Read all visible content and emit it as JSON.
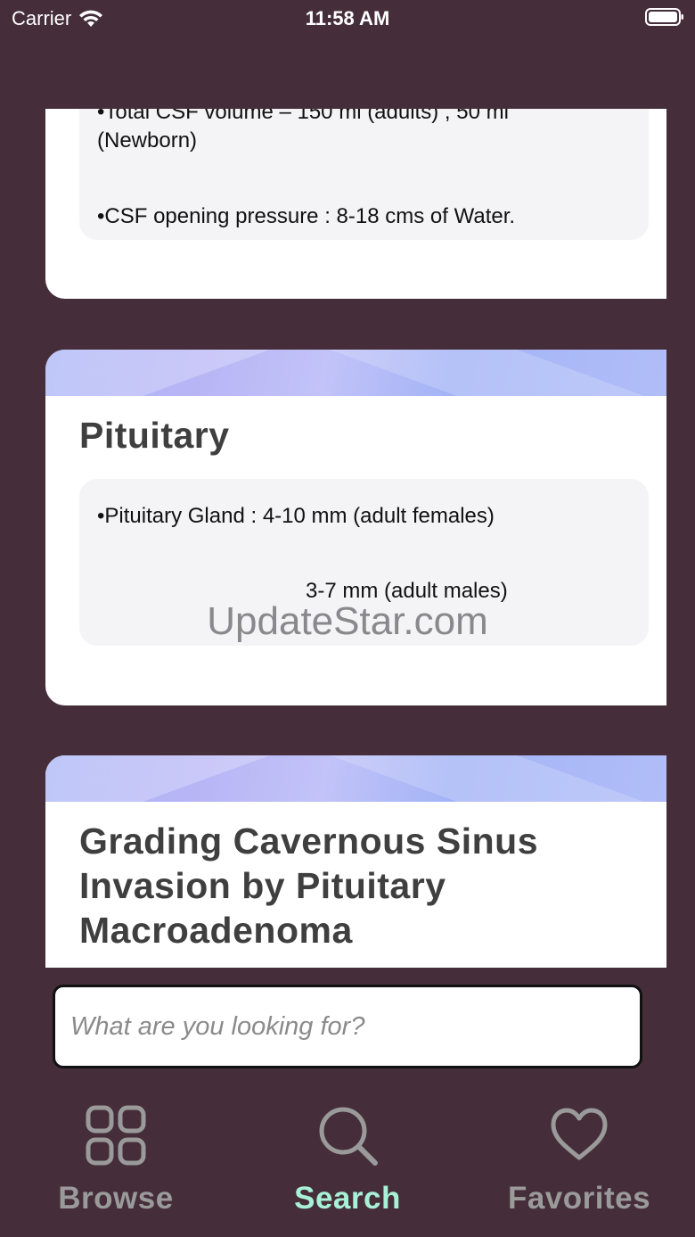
{
  "status_bar": {
    "carrier": "Carrier",
    "time": "11:58 AM"
  },
  "cards": [
    {
      "title": "",
      "lines": [
        "•Total CSF volume – 150 ml (adults) , 50 ml (Newborn)",
        "•CSF opening pressure : 8-18 cms of Water."
      ]
    },
    {
      "title": "Pituitary",
      "lines": [
        "•Pituitary Gland : 4-10 mm (adult females)",
        "3-7 mm (adult males)"
      ]
    },
    {
      "title": "Grading Cavernous Sinus Invasion by Pituitary Macroadenoma",
      "lines": []
    }
  ],
  "watermark": "UpdateStar.com",
  "search": {
    "placeholder": "What are you looking for?",
    "value": ""
  },
  "tabs": [
    {
      "label": "Browse",
      "icon": "grid-icon"
    },
    {
      "label": "Search",
      "icon": "search-icon"
    },
    {
      "label": "Favorites",
      "icon": "heart-icon"
    }
  ],
  "colors": {
    "background": "#452e39",
    "tab_active": "#a8f0d6",
    "tab_inactive": "#9a9a9a",
    "card_banner": "#b0bdf8"
  },
  "active_tab": "Search"
}
